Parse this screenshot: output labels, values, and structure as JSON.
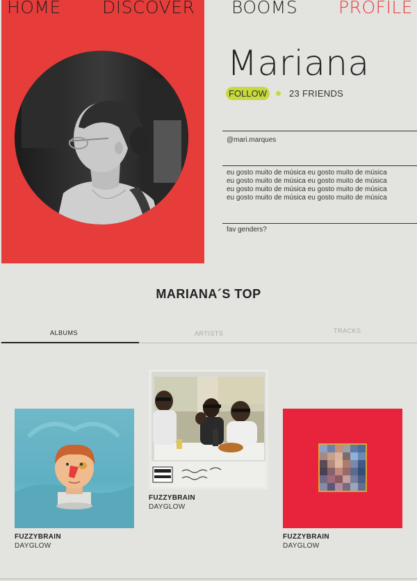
{
  "nav": {
    "home": "HOME",
    "discover": "DISCOVER",
    "booms": "BOOMS",
    "profile": "PROFILE"
  },
  "profile": {
    "name": "Mariana",
    "follow_label": "FOLLOW",
    "friends": "23 FRIENDS",
    "handle": "@mari.marques",
    "bio": [
      "eu gosto muito de música eu gosto muito de música",
      "eu gosto muito de música eu gosto muito de música",
      "eu gosto muito de música eu gosto muito de música",
      "eu gosto muito de música eu gosto muito de música"
    ],
    "fav_prompt": "fav genders?"
  },
  "top": {
    "title": "MARIANA´S TOP",
    "tabs": [
      "ALBUMS",
      "ARTISTS",
      "TRACKS"
    ],
    "active_tab": "ALBUMS"
  },
  "albums": [
    {
      "title": "FUZZYBRAIN",
      "artist": "DAYGLOW",
      "cover_icon": "clay-head-cover"
    },
    {
      "title": "FUZZYBRAIN",
      "artist": "DAYGLOW",
      "cover_icon": "polaroid-family-cover"
    },
    {
      "title": "FUZZYBRAIN",
      "artist": "DAYGLOW",
      "cover_icon": "red-pixel-cover"
    }
  ],
  "colors": {
    "accent_red": "#e63c3a",
    "accent_lime": "#c8d93c",
    "background": "#e3e3df"
  }
}
